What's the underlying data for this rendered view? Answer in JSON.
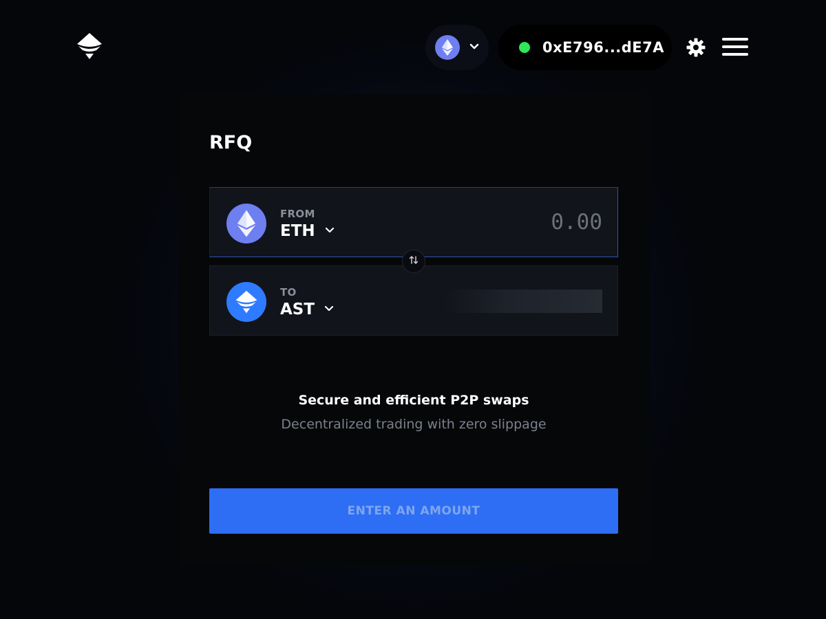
{
  "header": {
    "logo_icon": "airswap-logo-icon",
    "network": {
      "icon": "ethereum-icon",
      "chevron": "chevron-down-icon"
    },
    "wallet": {
      "status_color": "#2ee65a",
      "address": "0xE796...dE7A"
    },
    "settings_icon": "gear-icon",
    "menu_icon": "hamburger-menu-icon"
  },
  "card": {
    "title": "RFQ",
    "from": {
      "label": "FROM",
      "symbol": "ETH",
      "icon": "ethereum-icon",
      "amount_placeholder": "0.00",
      "amount_value": ""
    },
    "to": {
      "label": "TO",
      "symbol": "AST",
      "icon": "airswap-token-icon"
    },
    "swap_icon": "swap-arrows-icon",
    "headline": "Secure and efficient P2P swaps",
    "subline": "Decentralized trading with zero slippage",
    "cta_label": "ENTER AN AMOUNT"
  },
  "colors": {
    "accent": "#2e6ef5",
    "eth": "#6e7ff0",
    "ast": "#2f7bff",
    "background": "#05060a"
  }
}
